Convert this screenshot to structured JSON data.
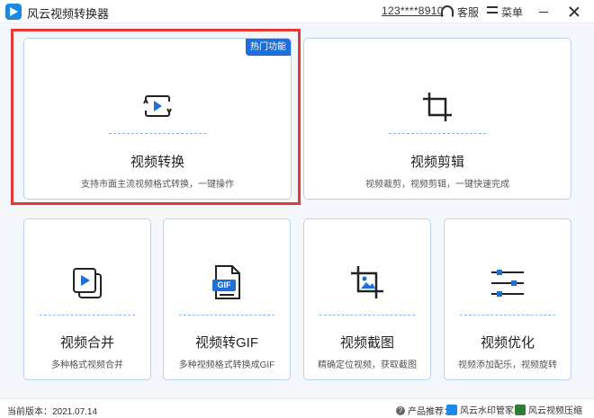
{
  "app": {
    "title": "风云视频转换器"
  },
  "titlebar": {
    "account": "123****8910",
    "service_label": "客服",
    "menu_label": "菜单"
  },
  "colors": {
    "accent": "#1e6fd9",
    "highlight": "#e53935",
    "card_border": "#b9d3f3"
  },
  "cards": [
    {
      "title": "视频转换",
      "desc": "支持市面主流视频格式转换，一键操作",
      "badge": "热门功能",
      "icon": "convert-icon"
    },
    {
      "title": "视频剪辑",
      "desc": "视频裁剪，视频剪辑，一键快速完成",
      "icon": "crop-icon"
    },
    {
      "title": "视频合并",
      "desc": "多种格式视频合并",
      "icon": "merge-icon"
    },
    {
      "title": "视频转GIF",
      "desc": "多种视频格式转换成GIF",
      "icon": "gif-icon",
      "icon_text": "GIF"
    },
    {
      "title": "视频截图",
      "desc": "精确定位视频，获取截图",
      "icon": "screenshot-icon"
    },
    {
      "title": "视频优化",
      "desc": "视频添加配乐，视频旋转",
      "icon": "sliders-icon"
    }
  ],
  "footer": {
    "version_label": "当前版本：2021.07.14",
    "recommend_label": "产品推荐：",
    "products": [
      "风云水印管家",
      "风云视频压缩"
    ]
  }
}
